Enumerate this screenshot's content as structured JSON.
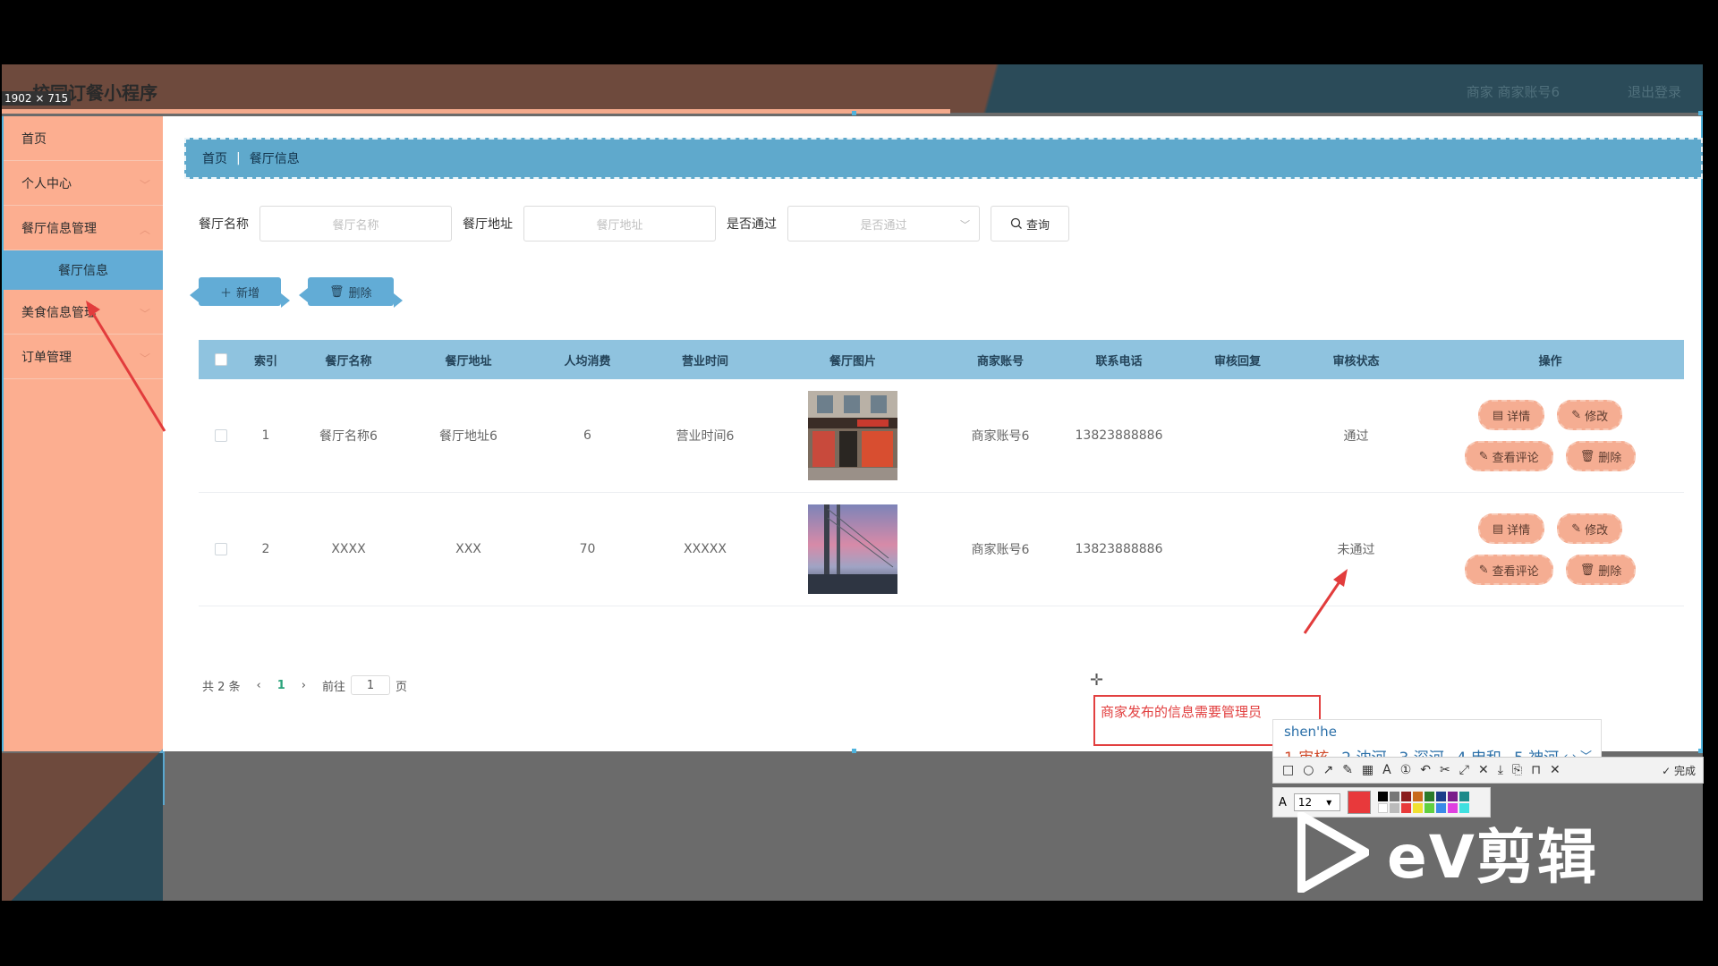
{
  "app": {
    "title": "校园订餐小程序",
    "user_info": "商家 商家账号6",
    "logout": "退出登录",
    "size_badge": "1902 × 715"
  },
  "sidebar": {
    "items": [
      {
        "label": "首页"
      },
      {
        "label": "个人中心"
      },
      {
        "label": "餐厅信息管理"
      },
      {
        "label": "餐厅信息"
      },
      {
        "label": "美食信息管理"
      },
      {
        "label": "订单管理"
      }
    ]
  },
  "breadcrumb": {
    "home": "首页",
    "current": "餐厅信息"
  },
  "search": {
    "name_label": "餐厅名称",
    "name_placeholder": "餐厅名称",
    "addr_label": "餐厅地址",
    "addr_placeholder": "餐厅地址",
    "pass_label": "是否通过",
    "pass_placeholder": "是否通过",
    "query_button": "查询"
  },
  "actions": {
    "add": "新增",
    "delete": "删除"
  },
  "table": {
    "headers": [
      "索引",
      "餐厅名称",
      "餐厅地址",
      "人均消费",
      "营业时间",
      "餐厅图片",
      "商家账号",
      "联系电话",
      "审核回复",
      "审核状态",
      "操作"
    ],
    "rows": [
      {
        "index": "1",
        "name": "餐厅名称6",
        "address": "餐厅地址6",
        "avg": "6",
        "hours": "营业时间6",
        "account": "商家账号6",
        "phone": "13823888886",
        "reply": "",
        "status": "通过"
      },
      {
        "index": "2",
        "name": "XXXX",
        "address": "XXX",
        "avg": "70",
        "hours": "XXXXX",
        "account": "商家账号6",
        "phone": "13823888886",
        "reply": "",
        "status": "未通过"
      }
    ],
    "row_ops": {
      "detail": "详情",
      "edit": "修改",
      "comments": "查看评论",
      "delete": "删除"
    }
  },
  "pager": {
    "total": "共 2 条",
    "current": "1",
    "goto_prefix": "前往",
    "goto_value": "1",
    "goto_suffix": "页"
  },
  "overlay": {
    "annotation": "商家发布的信息需要管理员",
    "ime_composition": "shen'he",
    "ime_candidates": [
      {
        "num": "1",
        "text": "审核"
      },
      {
        "num": "2",
        "text": "沈河"
      },
      {
        "num": "3",
        "text": "深河"
      },
      {
        "num": "4",
        "text": "申和"
      },
      {
        "num": "5",
        "text": "神河"
      }
    ],
    "done": "完成",
    "font_size": "12",
    "watermark": "eV剪辑"
  },
  "colors": {
    "accent_blue": "#62acd6",
    "accent_salmon": "#fcae90",
    "annotation_red": "#e24040"
  }
}
